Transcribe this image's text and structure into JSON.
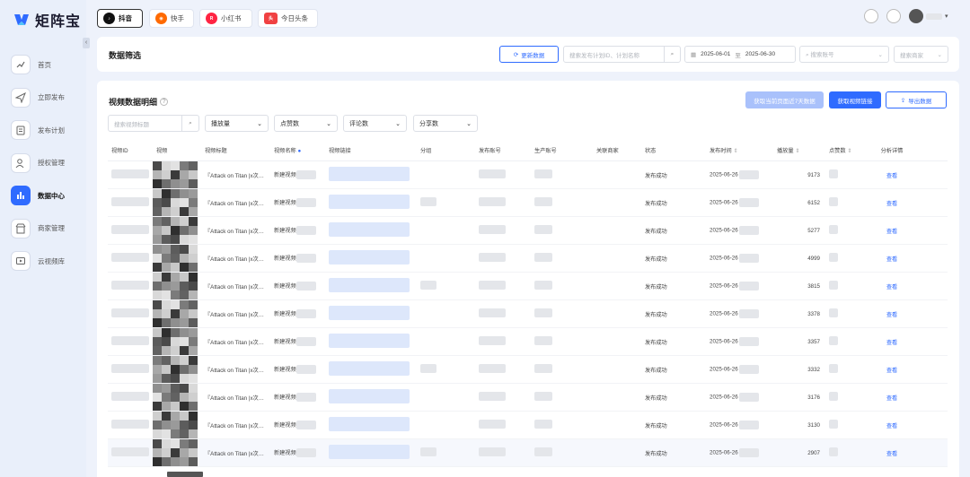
{
  "app": {
    "name": "矩阵宝"
  },
  "platform_tabs": [
    {
      "label": "抖音",
      "icon": "douyin-icon",
      "active": true
    },
    {
      "label": "快手",
      "icon": "kuaishou-icon"
    },
    {
      "label": "小红书",
      "icon": "xiaohongshu-icon"
    },
    {
      "label": "今日头条",
      "icon": "toutiao-icon"
    }
  ],
  "sidebar": {
    "items": [
      {
        "label": "首页",
        "icon": "chart-trend-icon"
      },
      {
        "label": "立即发布",
        "icon": "send-icon"
      },
      {
        "label": "发布计划",
        "icon": "clipboard-icon"
      },
      {
        "label": "授权管理",
        "icon": "user-check-icon"
      },
      {
        "label": "数据中心",
        "icon": "bar-chart-icon",
        "active": true
      },
      {
        "label": "商家管理",
        "icon": "store-icon"
      },
      {
        "label": "云视频库",
        "icon": "video-library-icon"
      }
    ]
  },
  "filter": {
    "title": "数据筛选",
    "refresh_label": "更新数据",
    "search_placeholder": "搜索发布计划ID、计划名称",
    "date_start": "2025-06-01",
    "date_sep": "至",
    "date_end": "2025-06-30",
    "account_placeholder": "搜索账号",
    "merchant_placeholder": "搜索商家"
  },
  "details": {
    "title": "视频数据明细",
    "btn_recent": "获取当前页面近7天数据",
    "btn_links": "获取视频链接",
    "btn_export": "导出数据",
    "title_search_placeholder": "搜索视频标题",
    "selects": [
      "播放量",
      "点赞数",
      "评论数",
      "分享数"
    ]
  },
  "table": {
    "headers": [
      "视频ID",
      "视频",
      "视频标题",
      "视频名称",
      "视频链接",
      "分组",
      "发布账号",
      "生产账号",
      "关联商家",
      "状态",
      "发布时间",
      "播放量",
      "点赞数",
      "分析详情"
    ],
    "title_prefix": "『Attack on Titan |x次…",
    "name_prefix": "新建视频",
    "status": "发布成功",
    "date_prefix": "2025-06-26",
    "action": "查看",
    "rows": [
      {
        "plays": "9173"
      },
      {
        "plays": "6152"
      },
      {
        "plays": "5277"
      },
      {
        "plays": "4999"
      },
      {
        "plays": "3815"
      },
      {
        "plays": "3378"
      },
      {
        "plays": "3357"
      },
      {
        "plays": "3332"
      },
      {
        "plays": "3176"
      },
      {
        "plays": "3130"
      },
      {
        "plays": "2907"
      }
    ]
  },
  "colors": {
    "accent": "#2f6bff",
    "background": "#eef2fb"
  }
}
